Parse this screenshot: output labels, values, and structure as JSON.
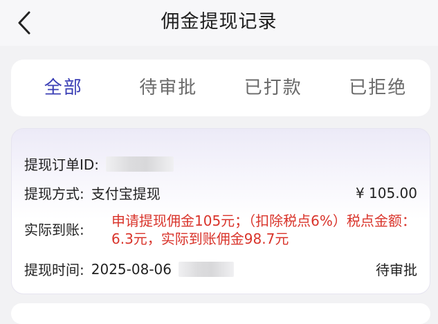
{
  "nav": {
    "title": "佣金提现记录",
    "back_icon": "chevron-left-icon"
  },
  "tabs": [
    {
      "label": "全部",
      "active": true
    },
    {
      "label": "待审批",
      "active": false
    },
    {
      "label": "已打款",
      "active": false
    },
    {
      "label": "已拒绝",
      "active": false
    }
  ],
  "colors": {
    "accent": "#3b3fb5",
    "highlight_red": "#d9342b"
  },
  "record": {
    "order_id_label": "提现订单ID:",
    "method_label": "提现方式:",
    "method_value": "支付宝提现",
    "amount": "¥ 105.00",
    "actual_label": "实际到账:",
    "actual_text": "申请提现佣金105元；（扣除税点6%）税点金额：6.3元，实际到账佣金98.7元",
    "time_label": "提现时间:",
    "time_value": "2025-08-06",
    "status": "待审批"
  }
}
